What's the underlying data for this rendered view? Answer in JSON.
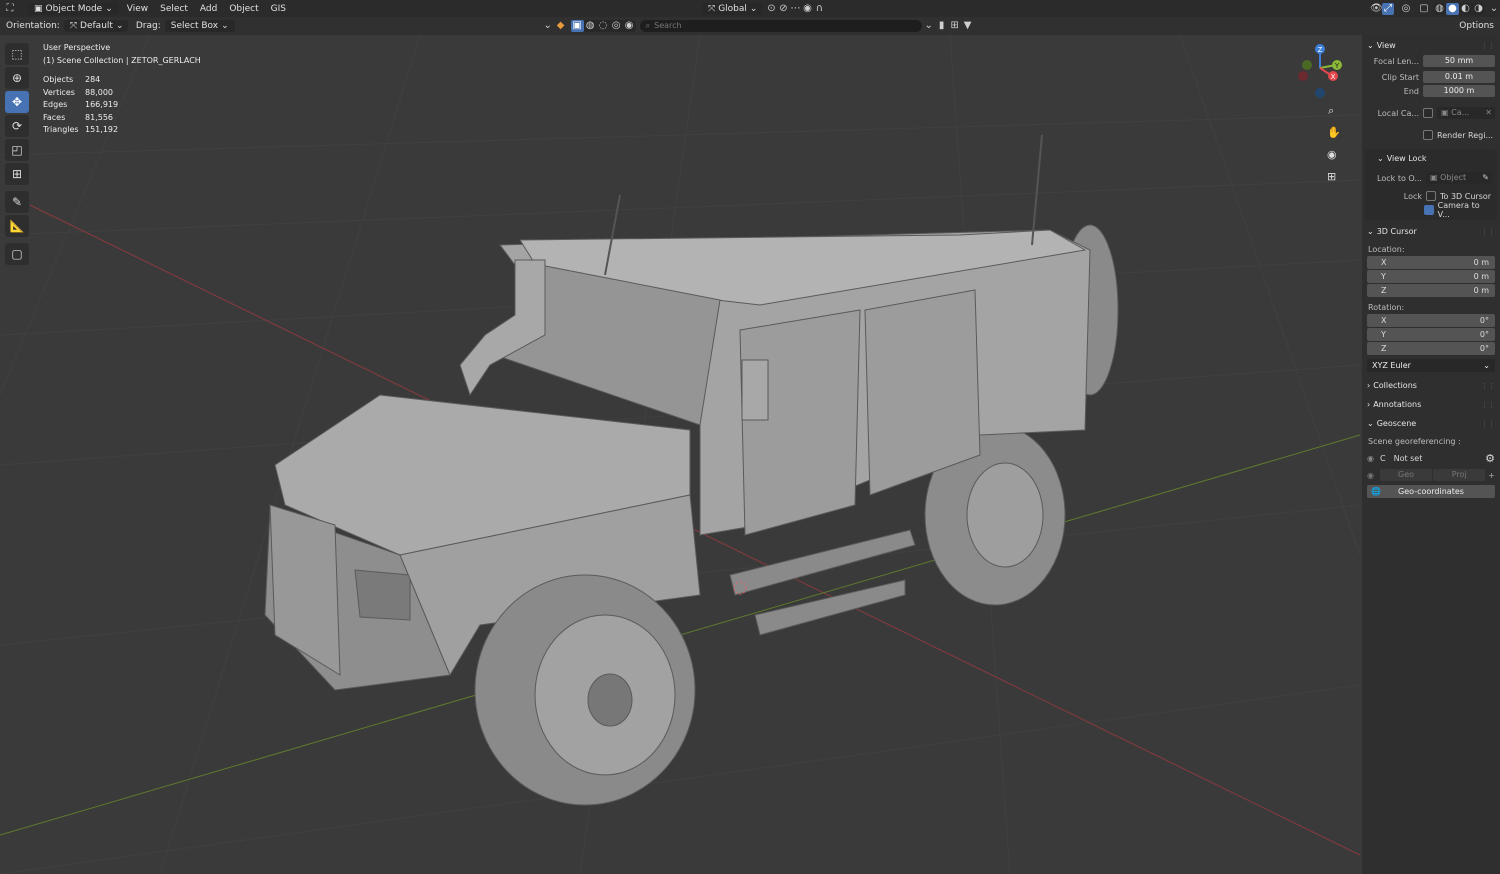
{
  "header": {
    "mode": "Object Mode",
    "menus": [
      "View",
      "Select",
      "Add",
      "Object",
      "GIS"
    ],
    "transform_orientation": "Global",
    "options_label": "Options"
  },
  "toolheader": {
    "orientation_label": "Orientation:",
    "orientation_value": "Default",
    "drag_label": "Drag:",
    "drag_value": "Select Box",
    "search_placeholder": "Search"
  },
  "viewport": {
    "perspective": "User Perspective",
    "collection": "(1) Scene Collection | ZETOR_GERLACH",
    "stats": [
      {
        "label": "Objects",
        "value": "284"
      },
      {
        "label": "Vertices",
        "value": "88,000"
      },
      {
        "label": "Edges",
        "value": "166,919"
      },
      {
        "label": "Faces",
        "value": "81,556"
      },
      {
        "label": "Triangles",
        "value": "151,192"
      }
    ],
    "gizmo": {
      "x": "X",
      "y": "Y",
      "z": "Z"
    }
  },
  "sidebar": {
    "view": {
      "title": "View",
      "focal_label": "Focal Len...",
      "focal_value": "50 mm",
      "clip_start_label": "Clip Start",
      "clip_start_value": "0.01 m",
      "end_label": "End",
      "end_value": "1000 m",
      "local_camera_label": "Local Ca...",
      "local_camera_value": "Ca...",
      "render_region_label": "Render Regi..."
    },
    "view_lock": {
      "title": "View Lock",
      "lock_to_label": "Lock to O...",
      "lock_to_placeholder": "Object",
      "lock_label": "Lock",
      "to_3d_cursor": "To 3D Cursor",
      "camera_to_view": "Camera to V..."
    },
    "cursor": {
      "title": "3D Cursor",
      "location_label": "Location:",
      "location": [
        {
          "axis": "X",
          "value": "0 m"
        },
        {
          "axis": "Y",
          "value": "0 m"
        },
        {
          "axis": "Z",
          "value": "0 m"
        }
      ],
      "rotation_label": "Rotation:",
      "rotation": [
        {
          "axis": "X",
          "value": "0°"
        },
        {
          "axis": "Y",
          "value": "0°"
        },
        {
          "axis": "Z",
          "value": "0°"
        }
      ],
      "rotation_mode": "XYZ Euler"
    },
    "collections_title": "Collections",
    "annotations_title": "Annotations",
    "geoscene": {
      "title": "Geoscene",
      "georef_label": "Scene georeferencing :",
      "crs_prefix": "C",
      "status": "Not set",
      "geo_label": "Geo",
      "proj_label": "Proj",
      "geo_coordinates": "Geo-coordinates"
    }
  },
  "colors": {
    "accent": "#4772b3",
    "x_axis": "#e0474d",
    "y_axis": "#8bb836",
    "z_axis": "#3d7fd8"
  }
}
